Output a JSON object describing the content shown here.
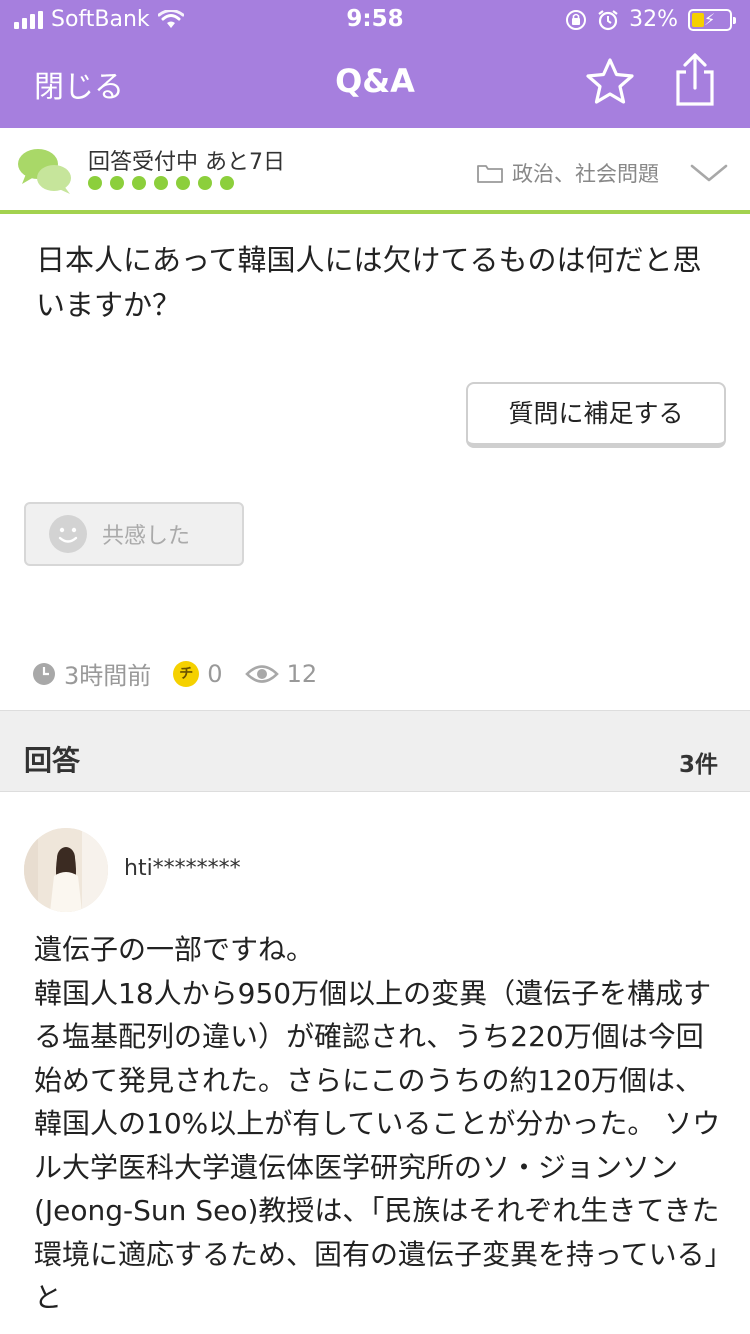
{
  "status_bar": {
    "carrier": "SoftBank",
    "time": "9:58",
    "battery": "32%",
    "battery_level": 0.32
  },
  "nav": {
    "close_label": "閉じる",
    "title": "Q&A",
    "icons": [
      "star-icon",
      "share-icon"
    ]
  },
  "question": {
    "state": "回答受付中 あと7日",
    "progress_dots": 7,
    "category": "政治、社会問題",
    "text": "日本人にあって韓国人には欠けてるものは何だと思いますか？",
    "supplement_label": "質問に補足する",
    "empathy_label": "共感した",
    "posted": "3時間前",
    "coins": "0",
    "coin_icon_label": "チ",
    "views": "12"
  },
  "answers": {
    "section_title": "回答",
    "count": "3件",
    "items": [
      {
        "user": "hti********",
        "text": "遺伝子の一部ですね。\n韓国人18人から950万個以上の変異（遺伝子を構成する塩基配列の違い）が確認され、うち220万個は今回始めて発見された。さらにこのうちの約120万個は、韓国人の10%以上が有していることが分かった。 ソウル大学医科大学遺伝体医学研究所のソ・ジョンソン(Jeong-Sun Seo)教授は、「民族はそれぞれ生きてきた環境に適応するため、固有の遺伝子変異を持っている」と"
      }
    ]
  },
  "colors": {
    "header": "#a67fde",
    "accent_green": "#8ccf3c",
    "divider_green": "#a3d24f",
    "coin": "#f5d100"
  }
}
